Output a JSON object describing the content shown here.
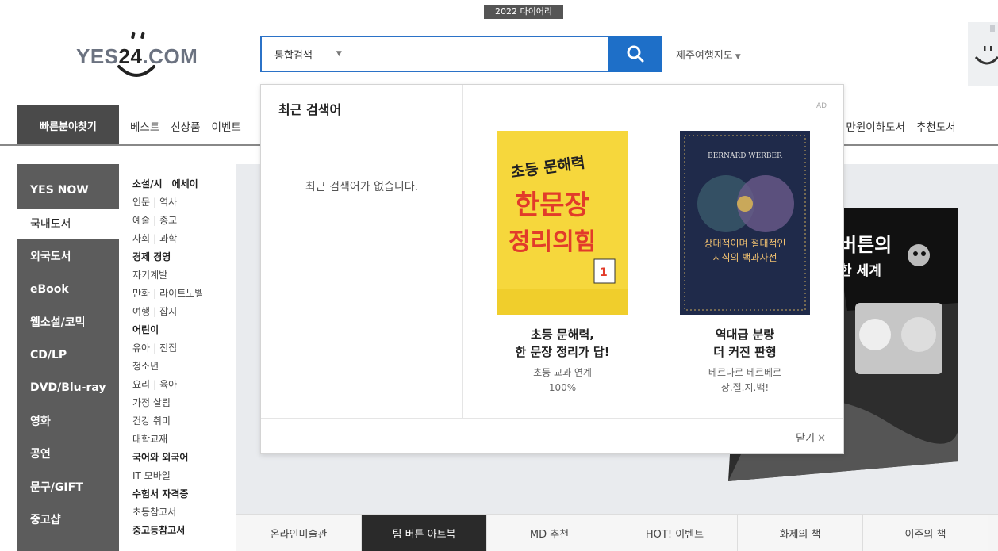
{
  "top_badge": "2022 다이어리",
  "logo": {
    "yes": "YES",
    "num": "24",
    "com": ".COM"
  },
  "search": {
    "category": "통합검색",
    "placeholder": "",
    "trend_word": "제주여행지도"
  },
  "nav": {
    "quick_find": "빠른분야찾기",
    "left_items": [
      "베스트",
      "신상품",
      "이벤트"
    ],
    "right_items": [
      "즈",
      "만원이하도서",
      "추천도서"
    ]
  },
  "categories": [
    {
      "label": "YES NOW",
      "active": false
    },
    {
      "label": "국내도서",
      "active": true
    },
    {
      "label": "외국도서",
      "active": false
    },
    {
      "label": "eBook",
      "active": false
    },
    {
      "label": "웹소설/코믹",
      "active": false
    },
    {
      "label": "CD/LP",
      "active": false
    },
    {
      "label": "DVD/Blu-ray",
      "active": false
    },
    {
      "label": "영화",
      "active": false
    },
    {
      "label": "공연",
      "active": false
    },
    {
      "label": "문구/GIFT",
      "active": false
    },
    {
      "label": "중고샵",
      "active": false
    }
  ],
  "subcategories": [
    {
      "a": "소설/시",
      "b": "에세이",
      "bold": true
    },
    {
      "a": "인문",
      "b": "역사",
      "bold": false
    },
    {
      "a": "예술",
      "b": "종교",
      "bold": false
    },
    {
      "a": "사회",
      "b": "과학",
      "bold": false
    },
    {
      "a": "경제 경영",
      "b": "",
      "bold": true
    },
    {
      "a": "자기계발",
      "b": "",
      "bold": false
    },
    {
      "a": "만화",
      "b": "라이트노벨",
      "bold": false
    },
    {
      "a": "여행",
      "b": "잡지",
      "bold": false
    },
    {
      "a": "어린이",
      "b": "",
      "bold": true
    },
    {
      "a": "유아",
      "b": "전집",
      "bold": false
    },
    {
      "a": "청소년",
      "b": "",
      "bold": false
    },
    {
      "a": "요리",
      "b": "육아",
      "bold": false
    },
    {
      "a": "가정 살림",
      "b": "",
      "bold": false
    },
    {
      "a": "건강 취미",
      "b": "",
      "bold": false
    },
    {
      "a": "대학교재",
      "b": "",
      "bold": false
    },
    {
      "a": "국어와 외국어",
      "b": "",
      "bold": true
    },
    {
      "a": "IT 모바일",
      "b": "",
      "bold": false
    },
    {
      "a": "수험서 자격증",
      "b": "",
      "bold": true
    },
    {
      "a": "초등참고서",
      "b": "",
      "bold": false
    },
    {
      "a": "중고등참고서",
      "b": "",
      "bold": true
    }
  ],
  "bottom_tabs": [
    {
      "label": "온라인미술관",
      "active": false
    },
    {
      "label": "팀 버튼 아트북",
      "active": true
    },
    {
      "label": "MD 추천",
      "active": false
    },
    {
      "label": "HOT! 이벤트",
      "active": false
    },
    {
      "label": "화제의 책",
      "active": false
    },
    {
      "label": "이주의 책",
      "active": false
    }
  ],
  "banner": {
    "title_fragment": "버튼의",
    "subtitle_fragment": "한 세계"
  },
  "popup": {
    "recent_title": "최근 검색어",
    "recent_empty": "최근 검색어가 없습니다.",
    "ad_label": "AD",
    "close_label": "닫기",
    "books": [
      {
        "cover_top": "초등 문해력",
        "cover_main1": "한문장",
        "cover_main2": "정리의힘",
        "title": "초등 문해력,\n한 문장 정리가 답!",
        "desc": "초등 교과 연계\n100%",
        "cover_color": "#f6d73c"
      },
      {
        "cover_author": "BERNARD WERBER",
        "cover_main": "상대적이며 절대적인\n지식의 백과사전",
        "title": "역대급 분량\n더 커진 판형",
        "desc": "베르나르 베르베르\n상.절.지.백!",
        "cover_color": "#1f2a4a"
      }
    ]
  },
  "colors": {
    "accent_blue": "#1e6fc8",
    "category_dark": "#5c5c5c",
    "tab_active": "#2a2a2a"
  }
}
